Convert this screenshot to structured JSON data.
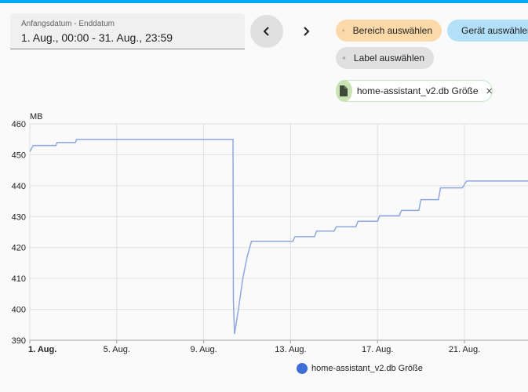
{
  "date_range": {
    "label": "Anfangsdatum - Enddatum",
    "value": "1. Aug., 00:00 - 31. Aug., 23:59"
  },
  "nav": {
    "prev_icon": "chevron-left-icon",
    "next_icon": "chevron-right-icon"
  },
  "chips": {
    "area": "Bereich auswählen",
    "device": "Gerät auswählen",
    "label": "Label auswählen",
    "entity": "home-assistant_v2.db Größe"
  },
  "colors": {
    "accent": "#03a9f4",
    "line": "#8fa8e0",
    "legend_dot": "#3e6fd8",
    "area_chip": "#fcd9a8",
    "device_chip": "#b3e0f9",
    "entity_icon_bg": "#c9e3b5"
  },
  "chart_data": {
    "type": "line",
    "ylabel": "MB",
    "ylim": [
      390,
      460
    ],
    "yticks": [
      390,
      400,
      410,
      420,
      430,
      440,
      450,
      460
    ],
    "xticks": [
      {
        "day": 1,
        "label": "1. Aug.",
        "bold": true
      },
      {
        "day": 5,
        "label": "5. Aug.",
        "bold": false
      },
      {
        "day": 9,
        "label": "9. Aug.",
        "bold": false
      },
      {
        "day": 13,
        "label": "13. Aug.",
        "bold": false
      },
      {
        "day": 17,
        "label": "17. Aug.",
        "bold": false
      },
      {
        "day": 21,
        "label": "21. Aug.",
        "bold": false
      }
    ],
    "series": [
      {
        "name": "home-assistant_v2.db Größe",
        "points": [
          [
            1.0,
            451
          ],
          [
            1.15,
            453
          ],
          [
            2.2,
            453
          ],
          [
            2.25,
            454
          ],
          [
            3.1,
            454
          ],
          [
            3.15,
            455
          ],
          [
            10.35,
            455
          ],
          [
            10.37,
            403
          ],
          [
            10.42,
            392
          ],
          [
            10.6,
            400
          ],
          [
            10.8,
            410
          ],
          [
            11.0,
            417
          ],
          [
            11.2,
            422
          ],
          [
            13.1,
            422
          ],
          [
            13.2,
            423.5
          ],
          [
            14.1,
            423.5
          ],
          [
            14.2,
            425.3
          ],
          [
            15.0,
            425.3
          ],
          [
            15.1,
            426.7
          ],
          [
            16.0,
            426.7
          ],
          [
            16.1,
            428.5
          ],
          [
            17.0,
            428.5
          ],
          [
            17.1,
            430.3
          ],
          [
            18.0,
            430.3
          ],
          [
            18.1,
            432
          ],
          [
            18.9,
            432
          ],
          [
            19.0,
            435.5
          ],
          [
            19.8,
            435.5
          ],
          [
            19.9,
            439.3
          ],
          [
            20.9,
            439.3
          ],
          [
            21.1,
            441.5
          ],
          [
            24.0,
            441.5
          ]
        ]
      }
    ]
  },
  "legend": {
    "label": "home-assistant_v2.db Größe"
  }
}
